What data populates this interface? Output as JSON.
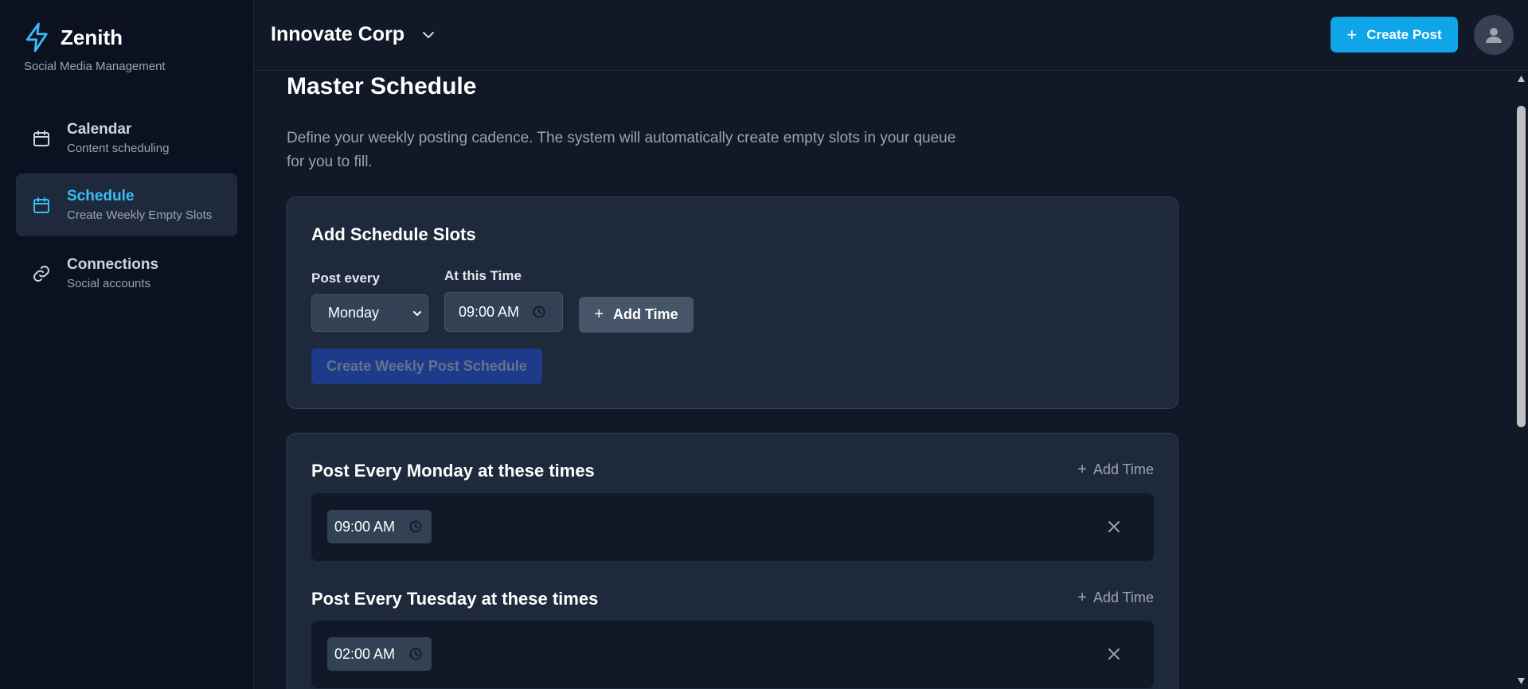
{
  "app": {
    "name": "Zenith",
    "tagline": "Social Media Management",
    "brand_color": "#38bdf8"
  },
  "sidebar": {
    "items": [
      {
        "title": "Calendar",
        "subtitle": "Content scheduling",
        "icon": "calendar-icon",
        "active": false
      },
      {
        "title": "Schedule",
        "subtitle": "Create Weekly Empty Slots",
        "icon": "calendar-icon",
        "active": true
      },
      {
        "title": "Connections",
        "subtitle": "Social accounts",
        "icon": "link-icon",
        "active": false
      }
    ]
  },
  "header": {
    "org_name": "Innovate Corp",
    "create_post_label": "Create Post",
    "accent": "#0ea5e9"
  },
  "main": {
    "title": "Master Schedule",
    "description": "Define your weekly posting cadence. The system will automatically create empty slots in your queue for you to fill.",
    "add_slots": {
      "title": "Add Schedule Slots",
      "post_every_label": "Post every",
      "post_every_value": "Monday",
      "time_label": "At this Time",
      "time_value": "09:00 AM",
      "add_time_label": "Add Time",
      "create_label": "Create Weekly Post Schedule"
    },
    "days": [
      {
        "title": "Post Every Monday at these times",
        "add_label": "Add Time",
        "slots": [
          "09:00 AM"
        ]
      },
      {
        "title": "Post Every Tuesday at these times",
        "add_label": "Add Time",
        "slots": [
          "02:00 AM"
        ]
      }
    ]
  }
}
